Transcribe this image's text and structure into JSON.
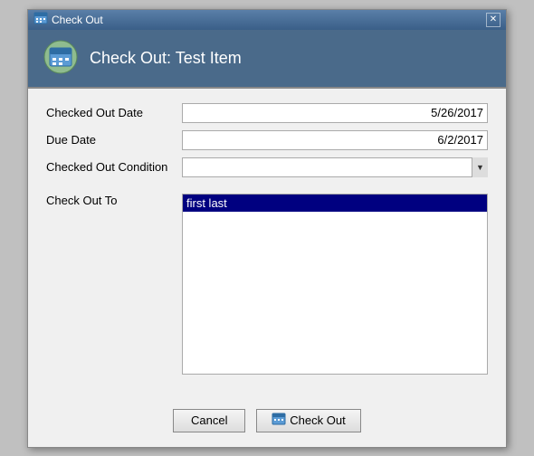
{
  "window": {
    "title": "Check Out",
    "header_title": "Check Out: Test Item"
  },
  "form": {
    "checked_out_date_label": "Checked Out Date",
    "checked_out_date_value": "5/26/2017",
    "due_date_label": "Due Date",
    "due_date_value": "6/2/2017",
    "checked_out_condition_label": "Checked Out Condition",
    "checked_out_condition_value": "",
    "check_out_to_label": "Check Out To",
    "check_out_to_item": "first last"
  },
  "buttons": {
    "cancel_label": "Cancel",
    "checkout_label": "Check Out"
  },
  "icons": {
    "title_bar": "📅",
    "header": "📅",
    "checkout_btn": "📅"
  }
}
